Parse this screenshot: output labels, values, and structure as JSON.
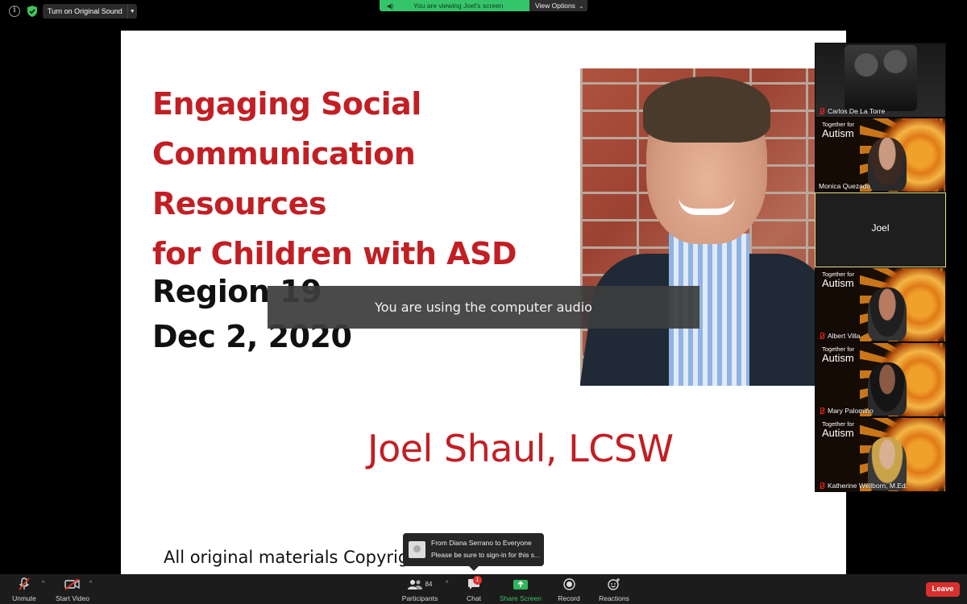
{
  "topbar": {
    "original_sound_label": "Turn on Original Sound",
    "viewing_text": "You are viewing Joel's screen",
    "view_options_label": "View Options"
  },
  "slide": {
    "title_lines": [
      "Engaging Social",
      "Communication Resources",
      "for Children with ASD"
    ],
    "region": "Region 19",
    "date": "Dec 2, 2020",
    "author": "Joel Shaul, LCSW",
    "copyright": "All original materials Copyright 2"
  },
  "audio_toast": "You are using the computer audio",
  "participants": [
    {
      "name": "Carlos De La Torre",
      "muted": true,
      "background": "camera"
    },
    {
      "name": "Monica Quezada",
      "muted": false,
      "background": "together-for-autism"
    },
    {
      "name": "Joel",
      "muted": false,
      "background": "none",
      "active_speaker": true
    },
    {
      "name": "Albert Villa",
      "muted": true,
      "background": "together-for-autism"
    },
    {
      "name": "Mary Palomino",
      "muted": true,
      "background": "together-for-autism"
    },
    {
      "name": "Katherine Wellborn, M.Ed.",
      "muted": true,
      "background": "together-for-autism"
    }
  ],
  "brand": {
    "small": "Together for",
    "big": "Autism"
  },
  "chat_toast": {
    "from": "From Diana Serrano to Everyone",
    "message": "Please be sure to sign-in for this s..."
  },
  "toolbar": {
    "unmute": "Unmute",
    "start_video": "Start Video",
    "participants": "Participants",
    "participant_count": "84",
    "chat": "Chat",
    "chat_badge": "1",
    "share_screen": "Share Screen",
    "record": "Record",
    "reactions": "Reactions",
    "leave": "Leave"
  },
  "colors": {
    "slide_title_red": "#c11f24",
    "viewing_green": "#36c46a",
    "share_green": "#2fb55a",
    "leave_red": "#d8302c",
    "speaker_border": "#e6e083"
  },
  "icons": [
    "info-icon",
    "shield-check-icon",
    "speaker-icon",
    "chevron-down-icon",
    "mic-muted-icon",
    "video-off-icon",
    "participants-icon",
    "chat-icon",
    "share-screen-icon",
    "record-icon",
    "reactions-icon"
  ]
}
